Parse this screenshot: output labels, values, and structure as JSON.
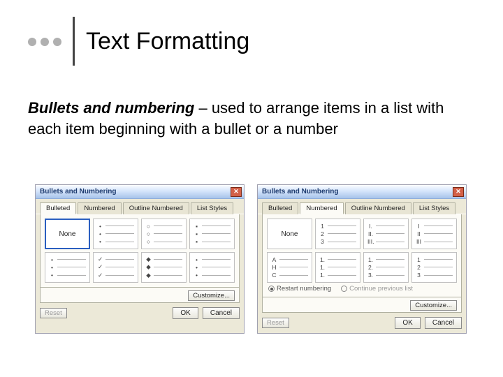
{
  "slide": {
    "title": "Text Formatting",
    "lead": "Bullets and numbering",
    "body": " – used to arrange items in a list with each item beginning with a bullet or a number"
  },
  "dialog": {
    "title": "Bullets and Numbering",
    "tabs": {
      "bulleted": "Bulleted",
      "numbered": "Numbered",
      "outline": "Outline Numbered",
      "styles": "List Styles"
    },
    "none": "None",
    "customize": "Customize...",
    "reset": "Reset",
    "ok": "OK",
    "cancel": "Cancel",
    "bulleted_samples": {
      "r1c2": "•",
      "r1c3": "○",
      "r1c4": "▪",
      "r2c1": "•",
      "r2c2": "✓",
      "r2c3": "◆",
      "r2c4": "•"
    },
    "numbered_samples": {
      "r1c2": [
        "1",
        "2",
        "3"
      ],
      "r1c3": [
        "I.",
        "II.",
        "III."
      ],
      "r1c4": [
        "I",
        "II",
        "III"
      ],
      "r2c1": [
        "A",
        "H",
        "C"
      ],
      "r2c2": [
        "1.",
        "1.",
        "1."
      ],
      "r2c3": [
        "1.",
        "2.",
        "3."
      ],
      "r2c4": [
        "1",
        "2",
        "3"
      ]
    },
    "radios": {
      "restart": "Restart numbering",
      "continue": "Continue previous list"
    }
  }
}
